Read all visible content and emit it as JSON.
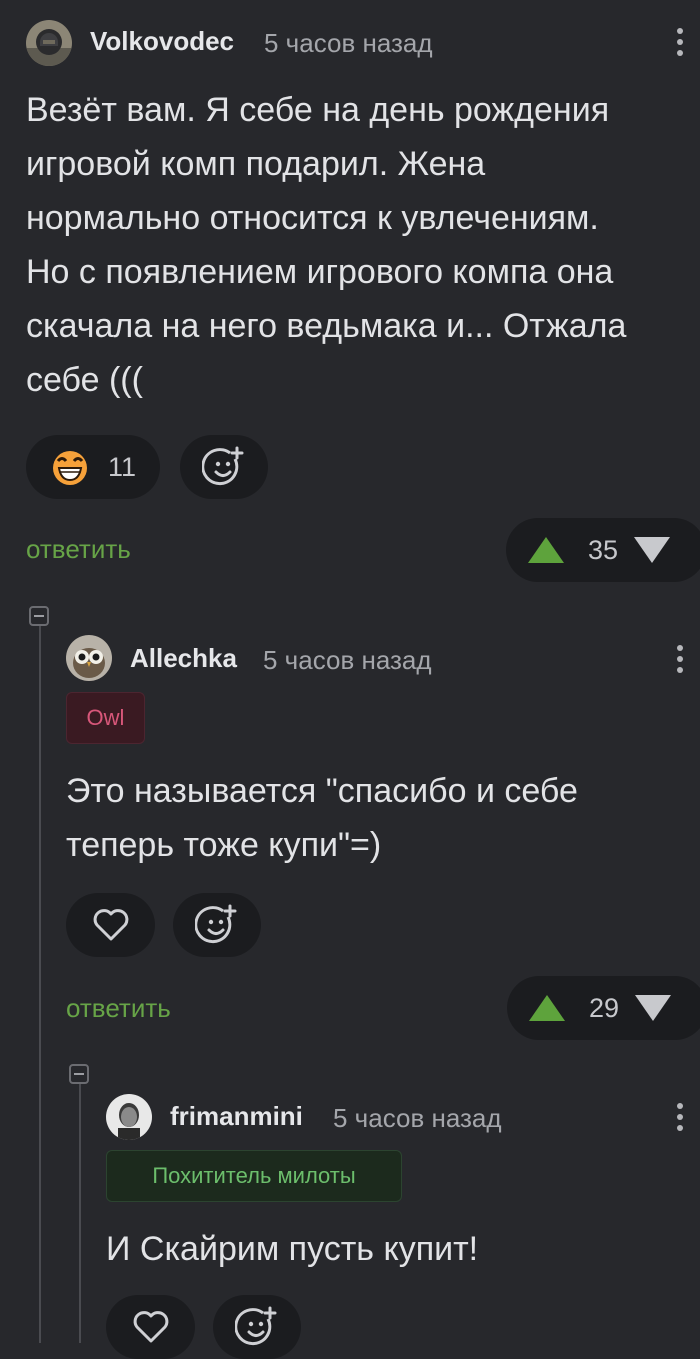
{
  "comments": [
    {
      "author": "Volkovodec",
      "time": "5 часов назад",
      "lines": [
        "Везёт вам. Я себе на день рождения",
        "игровой комп подарил. Жена",
        "нормально относится к увлечениям.",
        "Но с появлением игрового компа она",
        "скачала на него ведьмака и... Отжала",
        "себе ((("
      ],
      "reaction_count": "11",
      "reply_label": "ответить",
      "rating": "35"
    },
    {
      "author": "Allechka",
      "time": "5 часов назад",
      "tag": "Owl",
      "lines": [
        "Это называется \"спасибо и себе",
        "теперь тоже купи\"=)"
      ],
      "reply_label": "ответить",
      "rating": "29"
    },
    {
      "author": "frimanmini",
      "time": "5 часов назад",
      "tag": "Похититель милоты",
      "lines": [
        "И Скайрим пусть купит!"
      ]
    }
  ],
  "colors": {
    "background": "#27282c",
    "accent_green": "#67a447",
    "upvote": "#5ea33c",
    "owl_tag_bg": "#3a1a22",
    "owl_tag_text": "#d8577a",
    "green_tag_bg": "#1c2a1d",
    "green_tag_text": "#6cbe6c"
  },
  "icons": [
    "avatar-volkovodec",
    "grinning-emoji-icon",
    "add-emoji-icon",
    "heart-icon",
    "upvote-icon",
    "downvote-icon",
    "more-icon",
    "collapse-icon"
  ]
}
